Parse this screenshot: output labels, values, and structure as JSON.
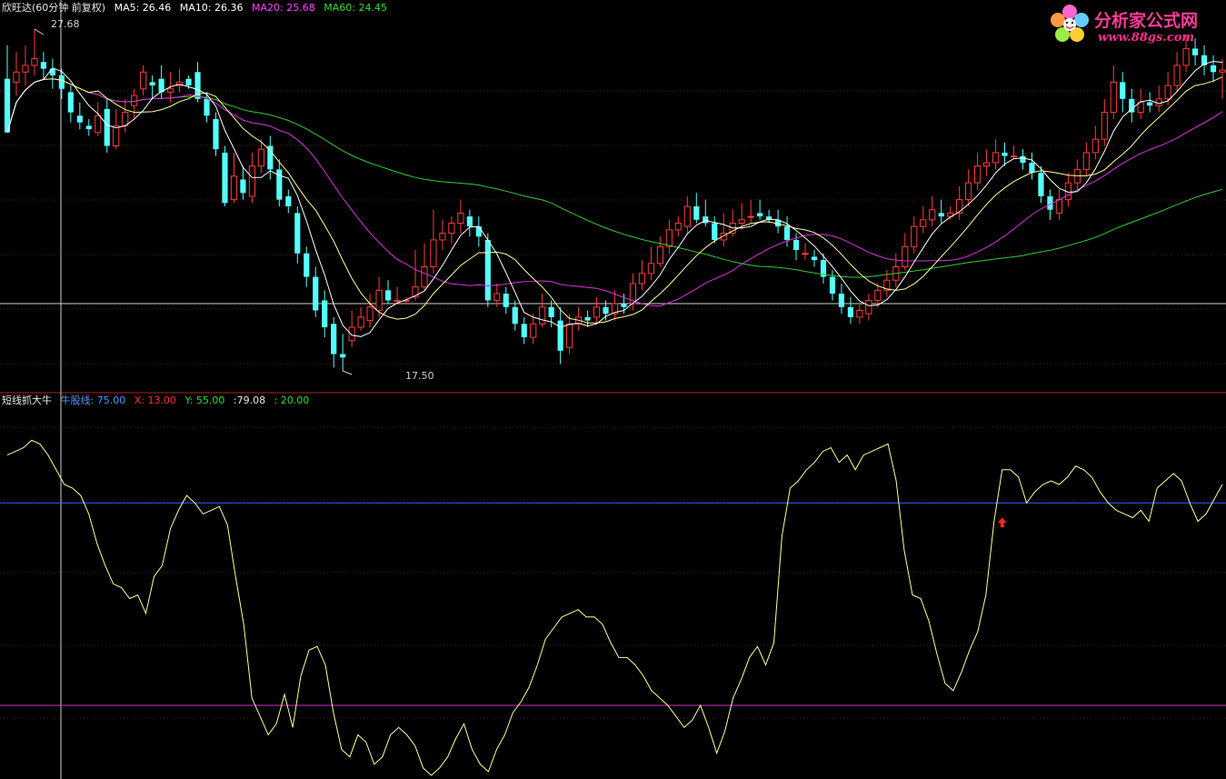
{
  "main_panel": {
    "title": "欣旺达(60分钟 前复权)",
    "ma": [
      {
        "label": "MA5: 26.46",
        "color": "#ffffff"
      },
      {
        "label": "MA10: 26.36",
        "color": "#ffffff"
      },
      {
        "label": "MA20: 25.68",
        "color": "#ff44ff"
      },
      {
        "label": "MA60: 24.45",
        "color": "#33dd33"
      }
    ],
    "high_marker": "27.68",
    "low_marker": "17.50"
  },
  "indicator_panel": {
    "title": "短线抓大牛",
    "values": [
      {
        "label": "牛股线: 75.00",
        "color": "#4a9bff"
      },
      {
        "label": "X: 13.00",
        "color": "#ff3333"
      },
      {
        "label": "Y: 55.00",
        "color": "#33dd33"
      },
      {
        "label": ":79.08",
        "color": "#e8e8e8"
      },
      {
        "label": ": 20.00",
        "color": "#33dd33"
      }
    ]
  },
  "watermark": {
    "brand": "分析家公式网",
    "url": "www.88gs.com"
  },
  "colors": {
    "background": "#000000",
    "up_candle": "#ff3b3b",
    "down_candle": "#55ffff",
    "ma5": "#ffffff",
    "ma10": "#ffff99",
    "ma20": "#dd33dd",
    "ma60": "#33cc33",
    "indicator_line": "#ffff99",
    "niugu_line": "#3366ff",
    "low_line": "#cc33cc",
    "arrow": "#ff2222"
  },
  "chart_data": [
    {
      "type": "candlestick",
      "title": "欣旺达(60分钟 前复权)",
      "y_range": [
        17.5,
        27.68
      ],
      "candles": [
        [
          26.2,
          24.6,
          27.2,
          24.6
        ],
        [
          26.1,
          26.4,
          27.0,
          25.7
        ],
        [
          26.4,
          26.6,
          27.2,
          26.0
        ],
        [
          26.6,
          26.8,
          27.68,
          26.3
        ],
        [
          26.7,
          26.5,
          27.0,
          26.2
        ],
        [
          26.5,
          26.3,
          26.8,
          25.9
        ],
        [
          26.3,
          25.9,
          26.5,
          25.6
        ],
        [
          25.8,
          25.2,
          26.0,
          24.9
        ],
        [
          25.1,
          24.9,
          25.5,
          24.7
        ],
        [
          24.8,
          24.7,
          25.0,
          24.5
        ],
        [
          24.6,
          25.1,
          25.5,
          24.5
        ],
        [
          25.3,
          24.2,
          25.6,
          24.0
        ],
        [
          24.2,
          24.8,
          25.3,
          24.1
        ],
        [
          24.8,
          25.2,
          25.6,
          24.6
        ],
        [
          25.4,
          25.7,
          25.9,
          25.0
        ],
        [
          25.9,
          26.4,
          26.6,
          25.7
        ],
        [
          26.1,
          26.0,
          26.3,
          25.6
        ],
        [
          26.2,
          25.8,
          26.6,
          25.6
        ],
        [
          25.8,
          25.9,
          26.4,
          25.5
        ],
        [
          26.0,
          26.1,
          26.5,
          25.8
        ],
        [
          26.2,
          26.0,
          26.3,
          25.9
        ],
        [
          26.4,
          25.6,
          26.7,
          25.5
        ],
        [
          25.6,
          25.1,
          25.8,
          24.9
        ],
        [
          25.0,
          24.1,
          25.2,
          23.9
        ],
        [
          24.0,
          22.5,
          24.2,
          22.4
        ],
        [
          22.6,
          23.3,
          24.0,
          22.5
        ],
        [
          23.2,
          22.8,
          23.6,
          22.6
        ],
        [
          22.7,
          23.6,
          24.0,
          22.5
        ],
        [
          23.6,
          24.1,
          24.4,
          23.4
        ],
        [
          24.2,
          23.5,
          24.5,
          23.2
        ],
        [
          23.5,
          22.6,
          23.8,
          22.4
        ],
        [
          22.7,
          22.4,
          22.9,
          22.2
        ],
        [
          22.2,
          21.0,
          22.4,
          20.7
        ],
        [
          21.0,
          20.3,
          21.2,
          20.0
        ],
        [
          20.3,
          19.3,
          20.6,
          19.1
        ],
        [
          19.6,
          18.8,
          19.9,
          18.5
        ],
        [
          18.9,
          18.0,
          19.1,
          17.6
        ],
        [
          18.0,
          17.9,
          18.6,
          17.5
        ],
        [
          18.4,
          18.8,
          19.3,
          18.2
        ],
        [
          18.8,
          19.1,
          19.4,
          18.7
        ],
        [
          19.0,
          19.4,
          19.8,
          18.8
        ],
        [
          19.3,
          19.9,
          20.3,
          19.1
        ],
        [
          19.9,
          19.6,
          20.2,
          19.5
        ],
        [
          19.6,
          19.6,
          20.0,
          19.5
        ],
        [
          19.6,
          19.6,
          19.7,
          19.5
        ],
        [
          19.7,
          20.0,
          21.1,
          19.6
        ],
        [
          20.0,
          20.6,
          21.3,
          19.9
        ],
        [
          20.6,
          21.4,
          22.3,
          20.4
        ],
        [
          21.4,
          21.6,
          22.0,
          21.1
        ],
        [
          21.6,
          21.9,
          22.1,
          21.3
        ],
        [
          21.9,
          22.2,
          22.6,
          21.6
        ],
        [
          22.1,
          21.8,
          22.3,
          21.5
        ],
        [
          21.8,
          21.5,
          22.1,
          21.2
        ],
        [
          21.4,
          19.6,
          21.6,
          19.4
        ],
        [
          19.6,
          19.8,
          20.1,
          19.4
        ],
        [
          19.8,
          19.4,
          20.0,
          19.2
        ],
        [
          19.4,
          18.9,
          19.6,
          18.7
        ],
        [
          18.9,
          18.5,
          19.1,
          18.3
        ],
        [
          18.5,
          18.9,
          19.2,
          18.3
        ],
        [
          18.9,
          19.4,
          19.8,
          18.8
        ],
        [
          19.4,
          19.1,
          19.6,
          18.8
        ],
        [
          19.0,
          18.1,
          19.4,
          17.7
        ],
        [
          18.2,
          18.9,
          19.2,
          18.0
        ],
        [
          18.9,
          19.1,
          19.4,
          18.7
        ],
        [
          19.1,
          19.0,
          19.3,
          18.8
        ],
        [
          19.1,
          19.4,
          19.7,
          18.9
        ],
        [
          19.4,
          19.2,
          19.6,
          19.0
        ],
        [
          19.2,
          19.5,
          19.9,
          19.0
        ],
        [
          19.5,
          19.4,
          19.8,
          19.2
        ],
        [
          19.5,
          20.1,
          20.4,
          19.3
        ],
        [
          20.1,
          20.4,
          20.8,
          19.9
        ],
        [
          20.4,
          20.7,
          21.2,
          20.2
        ],
        [
          20.7,
          21.2,
          21.5,
          20.6
        ],
        [
          21.2,
          21.7,
          22.0,
          21.0
        ],
        [
          21.7,
          21.9,
          22.1,
          21.5
        ],
        [
          21.8,
          22.4,
          22.7,
          21.6
        ],
        [
          22.4,
          22.0,
          22.8,
          21.9
        ],
        [
          22.1,
          21.9,
          22.6,
          21.8
        ],
        [
          21.9,
          21.4,
          22.1,
          21.3
        ],
        [
          21.4,
          21.6,
          22.2,
          21.2
        ],
        [
          21.6,
          21.9,
          22.3,
          21.5
        ],
        [
          21.9,
          22.0,
          22.5,
          21.7
        ],
        [
          22.1,
          22.1,
          22.6,
          21.9
        ],
        [
          22.2,
          22.1,
          22.6,
          22.0
        ],
        [
          22.1,
          22.0,
          22.3,
          21.9
        ],
        [
          22.0,
          21.8,
          22.3,
          21.6
        ],
        [
          21.8,
          21.4,
          22.1,
          21.2
        ],
        [
          21.4,
          21.1,
          21.6,
          20.8
        ],
        [
          21.0,
          21.0,
          21.3,
          20.8
        ],
        [
          20.9,
          20.8,
          21.1,
          20.6
        ],
        [
          20.8,
          20.3,
          21.0,
          20.1
        ],
        [
          20.3,
          19.8,
          20.5,
          19.6
        ],
        [
          19.8,
          19.4,
          20.1,
          19.2
        ],
        [
          19.4,
          19.1,
          19.7,
          18.9
        ],
        [
          19.1,
          19.3,
          19.5,
          18.9
        ],
        [
          19.2,
          19.6,
          19.8,
          19.0
        ],
        [
          19.6,
          19.9,
          20.1,
          19.4
        ],
        [
          19.9,
          20.2,
          20.5,
          19.7
        ],
        [
          20.2,
          20.6,
          21.0,
          20.0
        ],
        [
          20.6,
          21.2,
          21.6,
          20.5
        ],
        [
          21.2,
          21.8,
          22.1,
          21.0
        ],
        [
          21.8,
          22.0,
          22.4,
          21.6
        ],
        [
          22.0,
          22.3,
          22.7,
          21.8
        ],
        [
          22.2,
          22.1,
          22.6,
          21.9
        ],
        [
          22.1,
          22.2,
          22.4,
          22.0
        ],
        [
          22.2,
          22.6,
          23.0,
          22.0
        ],
        [
          22.6,
          23.1,
          23.5,
          22.4
        ],
        [
          23.1,
          23.6,
          24.0,
          22.9
        ],
        [
          23.6,
          23.7,
          24.1,
          23.3
        ],
        [
          23.7,
          24.0,
          24.4,
          23.5
        ],
        [
          24.0,
          23.9,
          24.3,
          23.6
        ],
        [
          23.9,
          23.9,
          24.2,
          23.8
        ],
        [
          23.9,
          23.7,
          24.1,
          23.5
        ],
        [
          23.7,
          23.4,
          24.0,
          23.2
        ],
        [
          23.4,
          22.7,
          23.6,
          22.5
        ],
        [
          22.7,
          22.3,
          22.9,
          22.0
        ],
        [
          22.2,
          22.6,
          22.9,
          22.0
        ],
        [
          22.6,
          23.1,
          23.4,
          22.4
        ],
        [
          23.1,
          23.5,
          23.8,
          22.9
        ],
        [
          23.5,
          24.0,
          24.3,
          23.3
        ],
        [
          24.0,
          24.4,
          24.8,
          23.8
        ],
        [
          24.4,
          25.2,
          25.6,
          24.2
        ],
        [
          25.2,
          26.1,
          26.6,
          25.0
        ],
        [
          26.1,
          25.6,
          26.4,
          25.2
        ],
        [
          25.6,
          25.2,
          25.9,
          24.9
        ],
        [
          25.2,
          25.5,
          25.9,
          25.0
        ],
        [
          25.5,
          25.4,
          25.8,
          25.2
        ],
        [
          25.4,
          25.6,
          26.0,
          25.2
        ],
        [
          25.6,
          26.0,
          26.4,
          25.4
        ],
        [
          26.0,
          26.6,
          27.0,
          25.8
        ],
        [
          26.6,
          27.1,
          27.5,
          26.4
        ],
        [
          27.1,
          26.9,
          27.4,
          26.6
        ],
        [
          26.9,
          26.6,
          27.2,
          26.3
        ],
        [
          26.6,
          26.4,
          26.9,
          26.1
        ],
        [
          26.4,
          26.46,
          26.8,
          25.6
        ]
      ]
    },
    {
      "type": "line",
      "title": "短线抓大牛",
      "y_range": [
        0,
        100
      ],
      "reference_lines": [
        75,
        20
      ],
      "series_values": [
        88,
        89,
        90,
        92,
        91,
        88,
        84,
        80,
        79,
        77,
        72,
        64,
        58,
        53,
        52,
        49,
        50,
        45,
        55,
        58,
        68,
        73,
        77,
        75,
        72,
        73,
        74,
        69,
        55,
        42,
        22,
        17,
        12,
        15,
        23,
        14,
        28,
        35,
        36,
        31,
        18,
        8,
        6,
        12,
        10,
        4,
        6,
        12,
        14,
        12,
        9,
        3,
        1,
        3,
        6,
        11,
        15,
        8,
        4,
        2,
        8,
        12,
        18,
        21,
        25,
        31,
        38,
        41,
        44,
        45,
        46,
        44,
        44,
        42,
        37,
        33,
        33,
        31,
        28,
        24,
        22,
        20,
        17,
        14,
        16,
        20,
        14,
        7,
        13,
        22,
        27,
        33,
        36,
        31,
        37,
        66,
        79,
        81,
        84,
        86,
        89,
        90,
        86,
        88,
        84,
        88,
        89,
        90,
        91,
        81,
        62,
        50,
        49,
        43,
        34,
        26,
        24,
        29,
        35,
        40,
        50,
        70,
        84,
        84,
        82,
        75,
        78,
        80,
        81,
        80,
        82,
        85,
        84,
        82,
        78,
        75,
        73,
        72,
        71,
        73,
        70,
        79,
        81,
        83,
        81,
        75,
        70,
        72,
        76,
        80
      ]
    }
  ]
}
